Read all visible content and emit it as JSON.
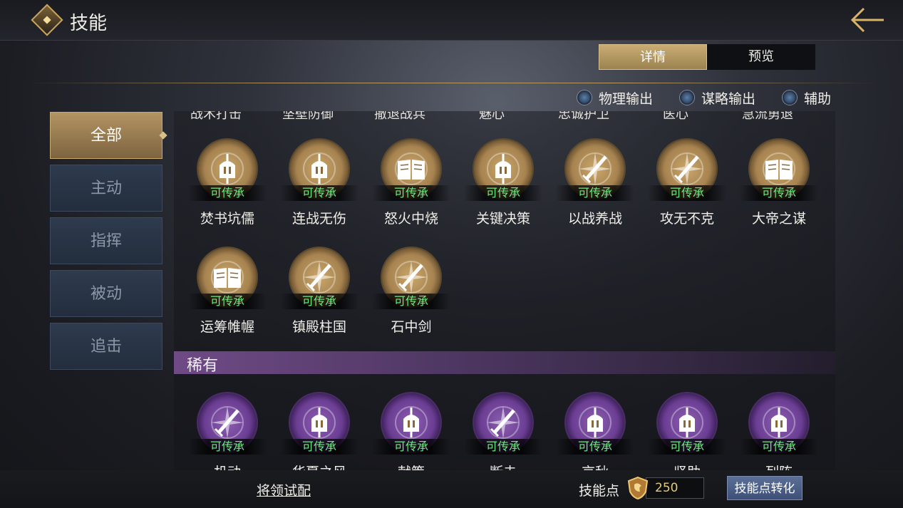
{
  "header": {
    "title": "技能",
    "back_icon": "back-arrow-icon"
  },
  "tabs": [
    {
      "label": "详情",
      "active": true
    },
    {
      "label": "预览",
      "active": false
    }
  ],
  "filters": [
    {
      "label": "物理输出"
    },
    {
      "label": "谋略输出"
    },
    {
      "label": "辅助"
    }
  ],
  "sidebar": {
    "items": [
      {
        "label": "全部",
        "active": true
      },
      {
        "label": "主动",
        "active": false
      },
      {
        "label": "指挥",
        "active": false
      },
      {
        "label": "被动",
        "active": false
      },
      {
        "label": "追击",
        "active": false
      }
    ]
  },
  "cut_row": {
    "labels": [
      "战术打击",
      "坚壁防御",
      "撤退战兵",
      "魅心",
      "忠诚护卫",
      "医心",
      "急流勇退"
    ]
  },
  "badge_text": "可传承",
  "gold_skills": [
    {
      "name": "焚书坑儒",
      "icon": "helmet-icon"
    },
    {
      "name": "连战无伤",
      "icon": "helmet-icon"
    },
    {
      "name": "怒火中烧",
      "icon": "book-icon"
    },
    {
      "name": "关键决策",
      "icon": "helmet-icon"
    },
    {
      "name": "以战养战",
      "icon": "sword-icon"
    },
    {
      "name": "攻无不克",
      "icon": "sword-icon"
    },
    {
      "name": "大帝之谋",
      "icon": "book-icon"
    },
    {
      "name": "运筹帷幄",
      "icon": "book-icon"
    },
    {
      "name": "镇殿柱国",
      "icon": "sword-icon"
    },
    {
      "name": "石中剑",
      "icon": "sword-icon"
    }
  ],
  "rare_section": {
    "label": "稀有"
  },
  "purple_skills": [
    {
      "name": "机动",
      "icon": "sword-icon"
    },
    {
      "name": "华夏之风",
      "icon": "helmet-icon"
    },
    {
      "name": "献策",
      "icon": "helmet-icon"
    },
    {
      "name": "断击",
      "icon": "sword-icon"
    },
    {
      "name": "京秋",
      "icon": "helmet-icon"
    },
    {
      "name": "坚助",
      "icon": "helmet-icon"
    },
    {
      "name": "列阵",
      "icon": "helmet-icon"
    }
  ],
  "bottom": {
    "trial_link": "将领试配",
    "skill_points_label": "技能点",
    "skill_points_value": "250",
    "convert_button": "技能点转化"
  },
  "colors": {
    "gold": "#c9a76a",
    "purple": "#6b3e94",
    "badge_green": "#6dea80"
  }
}
